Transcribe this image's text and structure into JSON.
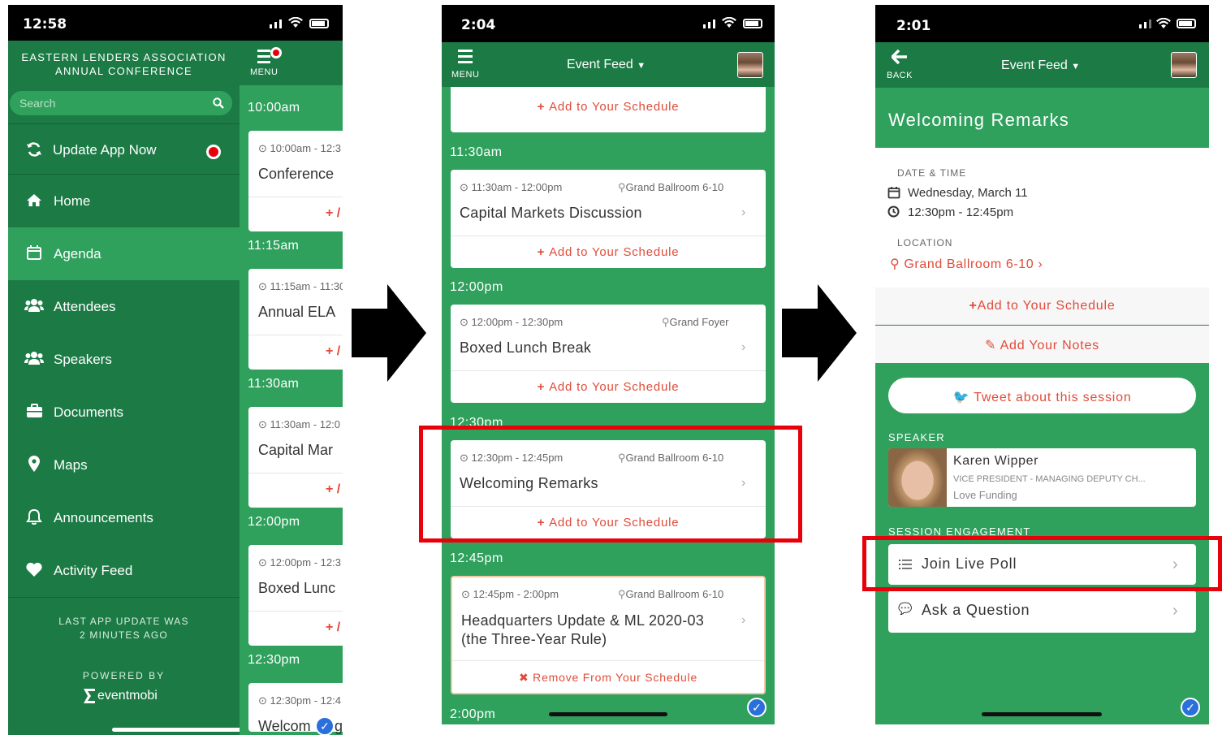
{
  "screen1": {
    "status_time": "12:58",
    "org_title_1": "EASTERN LENDERS ASSOCIATION",
    "org_title_2": "ANNUAL CONFERENCE",
    "search_placeholder": "Search",
    "menu_label": "MENU",
    "nav": [
      {
        "label": "Update App Now"
      },
      {
        "label": "Home"
      },
      {
        "label": "Agenda"
      },
      {
        "label": "Attendees"
      },
      {
        "label": "Speakers"
      },
      {
        "label": "Documents"
      },
      {
        "label": "Maps"
      },
      {
        "label": "Announcements"
      },
      {
        "label": "Activity Feed"
      }
    ],
    "last_update_1": "LAST APP UPDATE WAS",
    "last_update_2": "2 MINUTES AGO",
    "powered_by": "POWERED BY",
    "brand": "eventmobi",
    "agenda": [
      {
        "time": "10:00am",
        "range": "10:00am - 12:3",
        "title": "Conference",
        "add": "+ /"
      },
      {
        "time": "11:15am",
        "range": "11:15am - 11:30",
        "title": "Annual ELA",
        "add": "+ /"
      },
      {
        "time": "11:30am",
        "range": "11:30am - 12:0",
        "title": "Capital Mar",
        "add": "+ /"
      },
      {
        "time": "12:00pm",
        "range": "12:00pm - 12:3",
        "title": "Boxed Lunc",
        "add": "+ /"
      },
      {
        "time": "12:30pm",
        "range": "12:30pm - 12:4",
        "title": "Welcom",
        "title_after": "g"
      }
    ]
  },
  "screen2": {
    "status_time": "2:04",
    "menu_label": "MENU",
    "header": "Event Feed",
    "add_label": "Add to Your Schedule",
    "remove_label": "Remove From Your Schedule",
    "sessions": [
      {
        "time": "11:30am",
        "range": "11:30am - 12:00pm",
        "loc": "Grand Ballroom 6-10",
        "title": "Capital Markets Discussion"
      },
      {
        "time": "12:00pm",
        "range": "12:00pm - 12:30pm",
        "loc": "Grand Foyer",
        "title": "Boxed Lunch Break"
      },
      {
        "time": "12:30pm",
        "range": "12:30pm - 12:45pm",
        "loc": "Grand Ballroom 6-10",
        "title": "Welcoming Remarks"
      },
      {
        "time": "12:45pm",
        "range": "12:45pm - 2:00pm",
        "loc": "Grand Ballroom 6-10",
        "title": "Headquarters Update & ML 2020-03",
        "title2": "(the Three-Year Rule)"
      }
    ],
    "last_time": "2:00pm"
  },
  "screen3": {
    "status_time": "2:01",
    "back_label": "BACK",
    "header": "Event Feed",
    "title": "Welcoming Remarks",
    "date_label": "DATE & TIME",
    "date": "Wednesday, March 11",
    "time": "12:30pm - 12:45pm",
    "location_label": "LOCATION",
    "location": "Grand Ballroom 6-10",
    "add_label": "Add to Your Schedule",
    "notes_label": "Add Your Notes",
    "tweet_label": "Tweet about this session",
    "speaker_label": "SPEAKER",
    "speaker_name": "Karen Wipper",
    "speaker_role": "VICE PRESIDENT - MANAGING DEPUTY CH...",
    "speaker_org": "Love Funding",
    "engagement_label": "SESSION ENGAGEMENT",
    "poll_label": "Join Live Poll",
    "question_label": "Ask a Question"
  },
  "colors": {
    "green": "#2fa15d",
    "dark_green": "#1c7a45",
    "red_highlight": "#e8000b",
    "accent_red": "#e14b3a"
  }
}
